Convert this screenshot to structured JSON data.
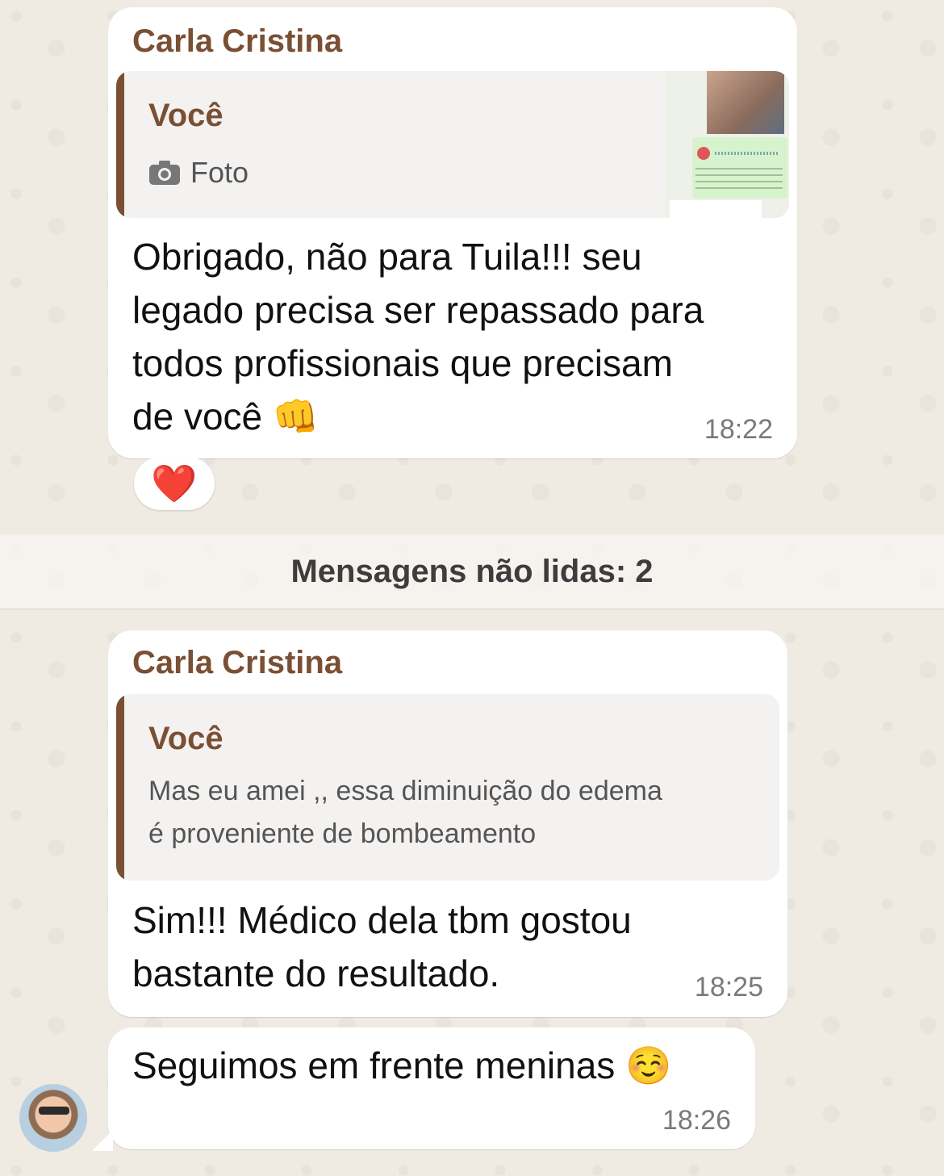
{
  "messages": [
    {
      "sender": "Carla Cristina",
      "quote": {
        "author": "Você",
        "type_icon": "camera-icon",
        "type_label": "Foto"
      },
      "lines": [
        "Obrigado, não para Tuila!!!  seu",
        "legado precisa ser repassado para",
        "todos profissionais que precisam",
        "de você 👊"
      ],
      "time": "18:22",
      "reaction": "❤️"
    },
    {
      "sender": "Carla Cristina",
      "quote": {
        "author": "Você",
        "lines": [
          "Mas eu amei ,, essa diminuição do edema",
          "é proveniente de bombeamento"
        ]
      },
      "lines": [
        "Sim!!! Médico dela tbm gostou",
        "bastante do resultado."
      ],
      "time": "18:25"
    },
    {
      "lines": [
        "Seguimos em frente meninas ☺️"
      ],
      "time": "18:26"
    }
  ],
  "unread_divider": "Mensagens não lidas: 2"
}
